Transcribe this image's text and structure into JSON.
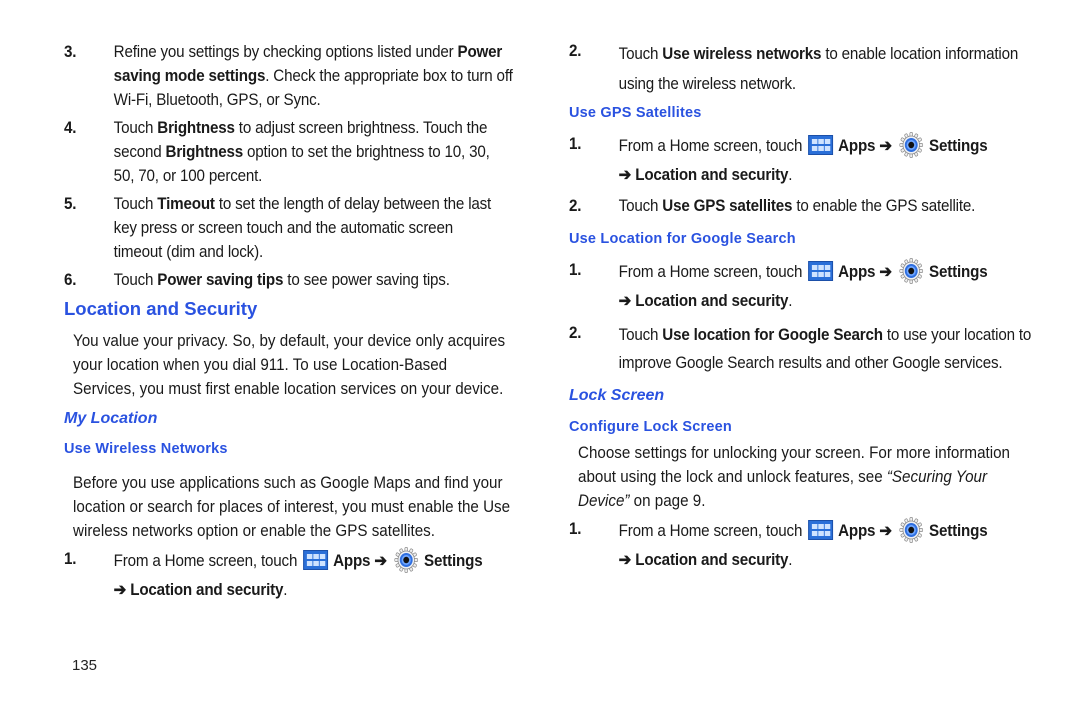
{
  "page_number": "135",
  "colors": {
    "heading_blue": "#2a52e0",
    "apps_icon_blue": "#2a6fd8"
  },
  "left": {
    "steps_top": [
      {
        "num": "3.",
        "lines": [
          [
            {
              "t": "Refine you settings by checking options listed under "
            },
            {
              "b": "Power"
            }
          ],
          [
            {
              "b": "saving mode settings"
            },
            {
              "t": ". Check the appropriate box to turn off"
            }
          ],
          [
            {
              "t": "Wi-Fi, Bluetooth, GPS, or Sync."
            }
          ]
        ]
      },
      {
        "num": "4.",
        "lines": [
          [
            {
              "t": "Touch "
            },
            {
              "b": "Brightness"
            },
            {
              "t": " to adjust screen brightness. Touch the"
            }
          ],
          [
            {
              "t": "second "
            },
            {
              "b": "Brightness"
            },
            {
              "t": " option to set the brightness to 10, 30,"
            }
          ],
          [
            {
              "t": "50, 70, or 100 percent."
            }
          ]
        ]
      },
      {
        "num": "5.",
        "lines": [
          [
            {
              "t": "Touch "
            },
            {
              "b": "Timeout"
            },
            {
              "t": " to set the length of delay between the last"
            }
          ],
          [
            {
              "t": "key press or screen touch and the automatic screen"
            }
          ],
          [
            {
              "t": "timeout (dim and lock)."
            }
          ]
        ]
      },
      {
        "num": "6.",
        "lines": [
          [
            {
              "t": "Touch "
            },
            {
              "b": "Power saving tips"
            },
            {
              "t": " to see power saving tips."
            }
          ]
        ]
      }
    ],
    "section_title": "Location and Security",
    "intro_lines": [
      "You value your privacy. So, by default, your device only acquires",
      "your location when you dial 911. To use Location-Based",
      "Services, you must first enable location services on your device."
    ],
    "subsection_title": "My Location",
    "wireless_title": "Use Wireless Networks",
    "wireless_lines": [
      "Before you use applications such as Google Maps and find your",
      "location or search for places of interest, you must enable the Use",
      "wireless networks option or enable the GPS satellites."
    ],
    "wireless_step1": {
      "num": "1.",
      "prefix": "From a Home screen, touch",
      "apps": "Apps",
      "arrow": "➔",
      "settings": "Settings",
      "path": "➔ Location and security",
      "period": "."
    }
  },
  "right": {
    "wireless_step2": {
      "num": "2.",
      "lines": [
        [
          {
            "t": "Touch "
          },
          {
            "b": "Use wireless networks"
          },
          {
            "t": " to enable location information"
          }
        ],
        [
          {
            "t": "using the wireless network."
          }
        ]
      ]
    },
    "gps_title": "Use GPS Satellites",
    "gps_step1": {
      "num": "1.",
      "prefix": "From a Home screen, touch",
      "apps": "Apps",
      "arrow": "➔",
      "settings": "Settings",
      "path": "➔ Location and security",
      "period": "."
    },
    "gps_step2": {
      "num": "2.",
      "lines": [
        [
          {
            "t": "Touch "
          },
          {
            "b": "Use GPS satellites"
          },
          {
            "t": " to enable the GPS satellite."
          }
        ]
      ]
    },
    "google_title": "Use Location for Google Search",
    "google_step1": {
      "num": "1.",
      "prefix": "From a Home screen, touch",
      "apps": "Apps",
      "arrow": "➔",
      "settings": "Settings",
      "path": "➔ Location and security",
      "period": "."
    },
    "google_step2": {
      "num": "2.",
      "lines": [
        [
          {
            "t": "Touch "
          },
          {
            "b": "Use location for Google Search"
          },
          {
            "t": " to use your location to"
          }
        ],
        [
          {
            "t": "improve Google Search results and other Google services."
          }
        ]
      ]
    },
    "lock_title": "Lock Screen",
    "configure_title": "Configure Lock Screen",
    "lock_lines": [
      [
        {
          "t": "Choose settings for unlocking your screen. For more information"
        }
      ],
      [
        {
          "t": "about using the lock and unlock features, see "
        },
        {
          "i": "“Securing Your"
        }
      ],
      [
        {
          "i": "Device”"
        },
        {
          "t": " on page 9."
        }
      ]
    ],
    "lock_step1": {
      "num": "1.",
      "prefix": "From a Home screen, touch",
      "apps": "Apps",
      "arrow": "➔",
      "settings": "Settings",
      "path": "➔ Location and security",
      "period": "."
    }
  }
}
